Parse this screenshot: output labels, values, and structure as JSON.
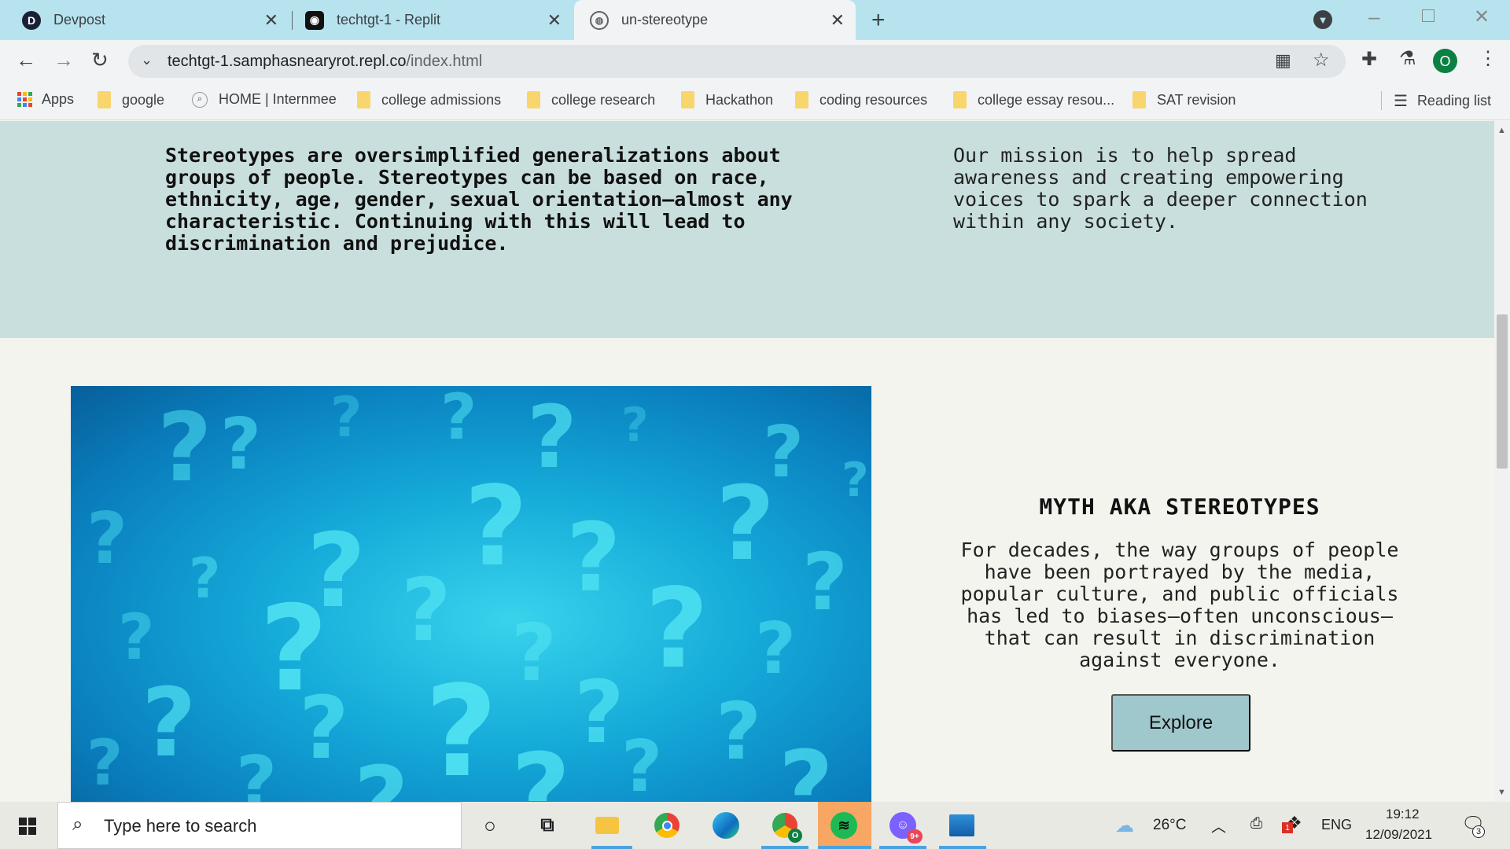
{
  "browser": {
    "tabs": [
      {
        "title": "Devpost",
        "favicon": "D"
      },
      {
        "title": "techtgt-1 - Replit",
        "favicon": "R"
      },
      {
        "title": "un-stereotype",
        "favicon": "globe"
      }
    ],
    "url_main": "techtgt-1.samphasnearyrot.repl.co",
    "url_path": "/index.html",
    "profile_initial": "O",
    "bookmarks": [
      {
        "label": "Apps"
      },
      {
        "label": "google"
      },
      {
        "label": "HOME | Internmee"
      },
      {
        "label": "college admissions"
      },
      {
        "label": "college research"
      },
      {
        "label": "Hackathon"
      },
      {
        "label": "coding resources"
      },
      {
        "label": "college essay resou..."
      },
      {
        "label": "SAT revision"
      }
    ],
    "reading_list": "Reading list"
  },
  "page": {
    "intro": "Stereotypes are oversimplified generalizations about groups of people. Stereotypes can be based on race, ethnicity, age, gender, sexual orientation—almost any characteristic. Continuing with this will lead to discrimination and prejudice.",
    "mission": "Our mission is to help spread awareness and creating empowering voices to spark a deeper connection within any society.",
    "myth_title": "MYTH AKA STEREOTYPES",
    "myth_text": "For decades, the way groups of people have been portrayed by the media, popular culture, and public officials has led to biases—often unconscious—that can result in discrimination against everyone.",
    "explore_label": "Explore",
    "image_glyph": "?"
  },
  "taskbar": {
    "search_placeholder": "Type here to search",
    "weather": "26°C",
    "language": "ENG",
    "time": "19:12",
    "date": "12/09/2021",
    "notification_count": "3",
    "discord_badge": "9+",
    "chrome_badge": "O",
    "dropbox_badge": "1"
  },
  "colors": {
    "tabstrip": "#b7e3ef",
    "band": "#c9dfde",
    "page_bg": "#f4f4ef",
    "button": "#9ec8cb"
  }
}
